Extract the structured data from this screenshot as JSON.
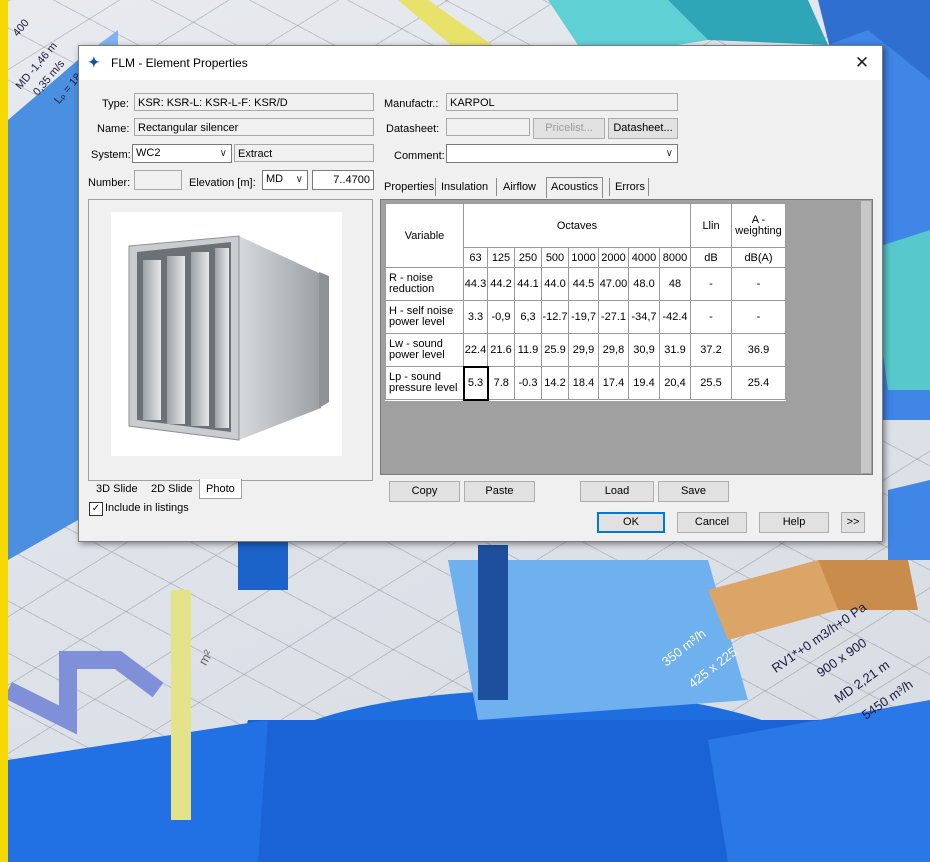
{
  "dialog": {
    "title": "FLM - Element Properties",
    "type_label": "Type:",
    "type_value": "KSR: KSR-L: KSR-L-F: KSR/D",
    "name_label": "Name:",
    "name_value": "Rectangular silencer",
    "system_label": "System:",
    "system_value": "WC2",
    "system_kind": "Extract",
    "number_label": "Number:",
    "number_value": "",
    "elevation_label": "Elevation [m]:",
    "elevation_ref": "MD",
    "elevation_value": "7..4700",
    "manufacturer_label": "Manufactr.:",
    "manufacturer_value": "KARPOL",
    "datasheet_label": "Datasheet:",
    "datasheet_value": "",
    "pricelist_button": "Pricelist...",
    "datasheet_button": "Datasheet...",
    "comment_label": "Comment:",
    "comment_value": "",
    "close_icon": "close-icon"
  },
  "photo_tabs": [
    "3D Slide",
    "2D Slide",
    "Photo"
  ],
  "include_in_listings": {
    "label": "Include in listings",
    "checked": true
  },
  "tabs": [
    "Properties",
    "Insulation",
    "Airflow",
    "Acoustics",
    "Errors"
  ],
  "active_tab": "Acoustics",
  "acoustics": {
    "variable_header": "Variable",
    "octaves_header": "Octaves",
    "llin_header": "Llin",
    "aweight_header": "A - weighting",
    "bands": [
      "63",
      "125",
      "250",
      "500",
      "1000",
      "2000",
      "4000",
      "8000"
    ],
    "llin_unit": "dB",
    "aweight_unit": "dB(A)",
    "rows": [
      {
        "name": "R - noise reduction",
        "values": [
          "44.3",
          "44.2",
          "44.1",
          "44.0",
          "44.5",
          "47.00",
          "48.0",
          "48"
        ],
        "llin": "-",
        "aweight": "-"
      },
      {
        "name": "H - self noise power level",
        "values": [
          "3.3",
          "-0,9",
          "6,3",
          "-12.7",
          "-19,7",
          "-27.1",
          "-34,7",
          "-42.4"
        ],
        "llin": "-",
        "aweight": "-"
      },
      {
        "name": "Lw - sound power level",
        "values": [
          "22.4",
          "21.6",
          "11.9",
          "25.9",
          "29,9",
          "29,8",
          "30,9",
          "31.9"
        ],
        "llin": "37.2",
        "aweight": "36.9"
      },
      {
        "name": "Lp - sound pressure level",
        "values": [
          "5.3",
          "7.8",
          "-0.3",
          "14.2",
          "18.4",
          "17.4",
          "19.4",
          "20,4"
        ],
        "llin": "25.5",
        "aweight": "25.4"
      }
    ]
  },
  "buttons": {
    "copy": "Copy",
    "paste": "Paste",
    "load": "Load",
    "save": "Save",
    "ok": "OK",
    "cancel": "Cancel",
    "help": "Help",
    "more": ">>"
  },
  "cad_labels": {
    "a": "400",
    "b": "MD -1,46 m",
    "c": "0,35 m/s",
    "d": "Lₚ = 18",
    "e": "350 m³/h",
    "f": "425 x 225",
    "g": "RV1*+0 m3/h+0 Pa",
    "h": "900 x 900",
    "i": "MD 2,21 m",
    "j": "5450 m³/h",
    "k": "m²"
  }
}
